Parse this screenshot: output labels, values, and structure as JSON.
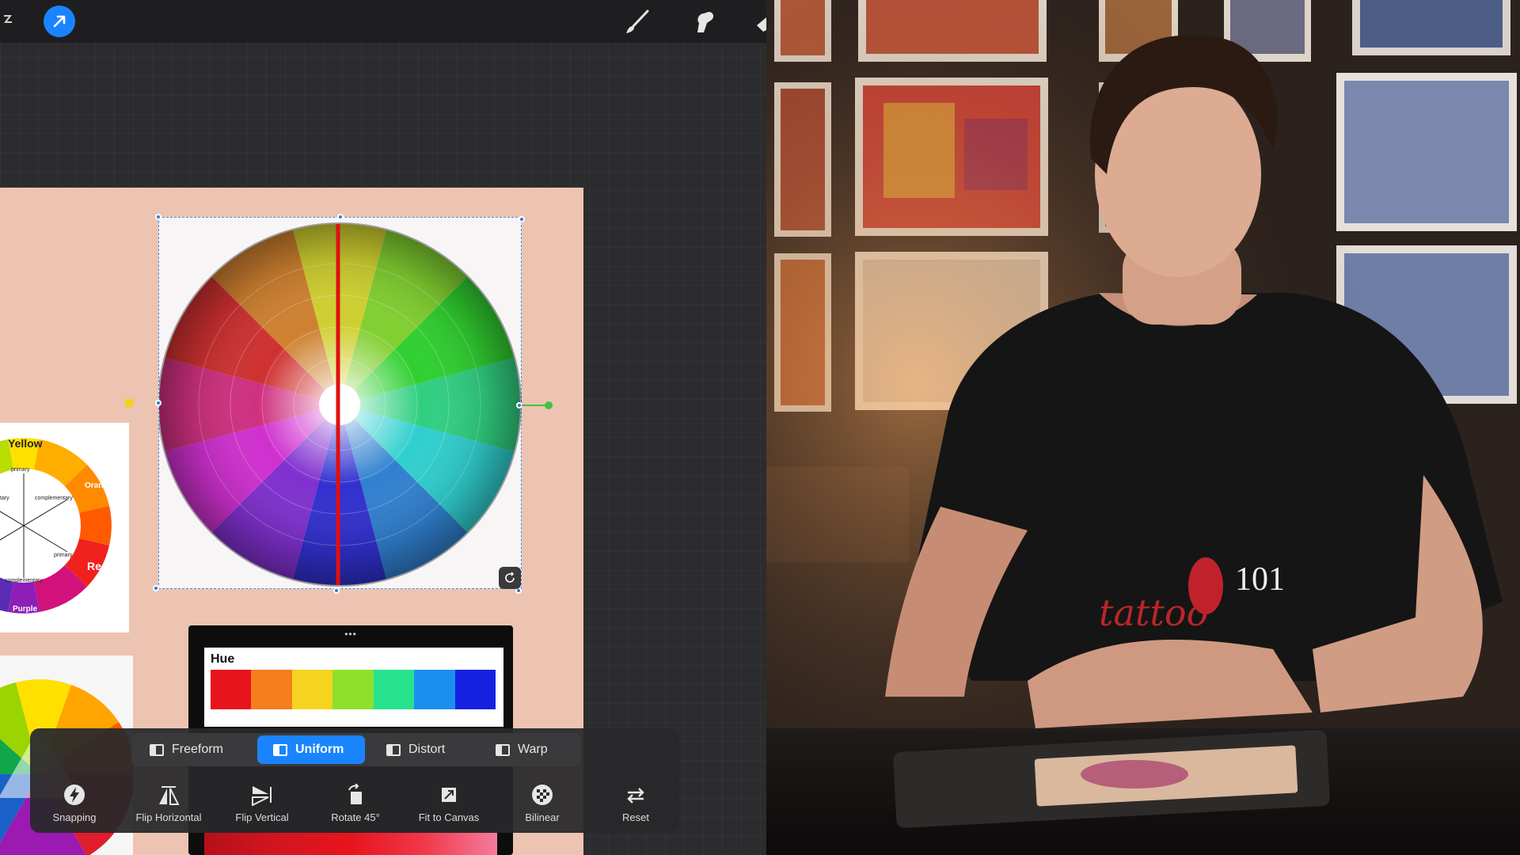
{
  "topbar": {
    "left_icons": [
      "menu-icon",
      "transform-arrow-icon"
    ],
    "right_icons": [
      "brush-icon",
      "smudge-icon",
      "eraser-icon"
    ],
    "accent": "#1a84ff"
  },
  "canvas": {
    "background": "#edc4b1",
    "pinned_wheel": {
      "labels": {
        "yellow": "Yellow",
        "orange": "Orange",
        "red": "Red",
        "purple": "Purple",
        "primary_top": "primary",
        "primary_bottom": "primary",
        "complementary_top": "complementary",
        "complementary_bottom": "complementary",
        "secondary": "tary"
      }
    },
    "hue_reference": {
      "menu_dots": "•••",
      "title": "Hue",
      "colors": [
        "#e8141c",
        "#f47d1c",
        "#f5d31f",
        "#8fe02c",
        "#27e38c",
        "#1b8ff0",
        "#1521e0"
      ]
    }
  },
  "transform_modes": {
    "active": "Uniform",
    "items": [
      {
        "label": "Freeform",
        "icon": "freeform-icon"
      },
      {
        "label": "Uniform",
        "icon": "uniform-icon"
      },
      {
        "label": "Distort",
        "icon": "distort-icon"
      },
      {
        "label": "Warp",
        "icon": "warp-icon"
      }
    ]
  },
  "transform_tools": [
    {
      "label": "Snapping",
      "icon": "snapping-icon"
    },
    {
      "label": "Flip Horizontal",
      "icon": "flip-horizontal-icon"
    },
    {
      "label": "Flip Vertical",
      "icon": "flip-vertical-icon"
    },
    {
      "label": "Rotate 45°",
      "icon": "rotate-icon"
    },
    {
      "label": "Fit to Canvas",
      "icon": "fit-to-canvas-icon"
    },
    {
      "label": "Bilinear",
      "icon": "bilinear-icon"
    },
    {
      "label": "Reset",
      "icon": "reset-icon"
    }
  ],
  "presenter": {
    "shirt_text": "tattoo",
    "shirt_number": "101"
  }
}
